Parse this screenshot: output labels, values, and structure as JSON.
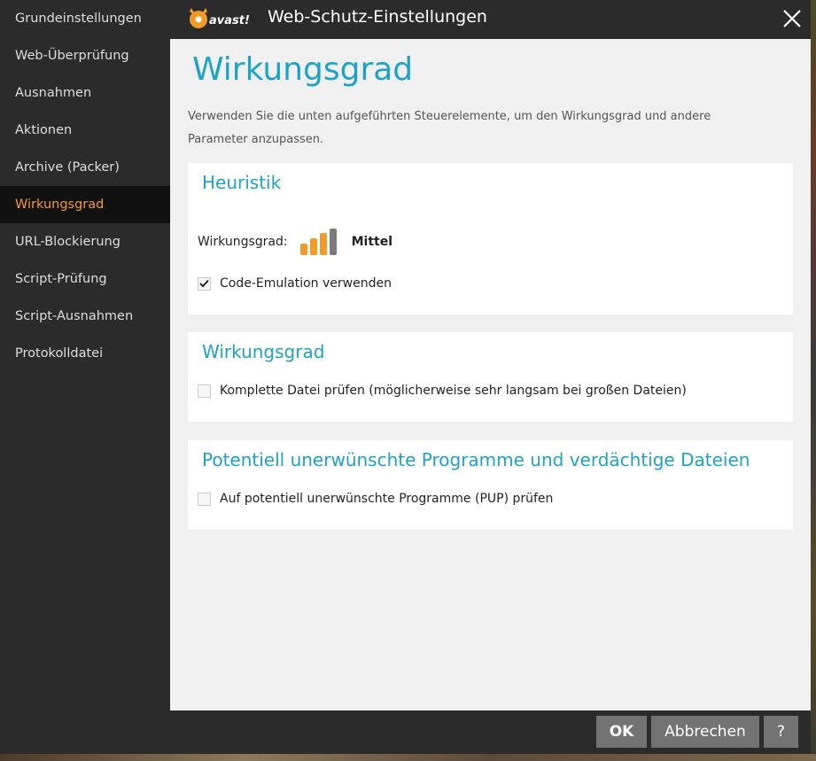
{
  "window": {
    "brand": "avast!",
    "title": "Web-Schutz-Einstellungen"
  },
  "sidebar": {
    "items": [
      {
        "label": "Grundeinstellungen",
        "active": false
      },
      {
        "label": "Web-Überprüfung",
        "active": false
      },
      {
        "label": "Ausnahmen",
        "active": false
      },
      {
        "label": "Aktionen",
        "active": false
      },
      {
        "label": "Archive (Packer)",
        "active": false
      },
      {
        "label": "Wirkungsgrad",
        "active": true
      },
      {
        "label": "URL-Blockierung",
        "active": false
      },
      {
        "label": "Script-Prüfung",
        "active": false
      },
      {
        "label": "Script-Ausnahmen",
        "active": false
      },
      {
        "label": "Protokolldatei",
        "active": false
      }
    ]
  },
  "main": {
    "title": "Wirkungsgrad",
    "description": "Verwenden Sie die unten aufgeführten Steuerelemente, um den Wirkungsgrad und andere Parameter anzupassen.",
    "sections": {
      "heuristik": {
        "title": "Heuristik",
        "level_label": "Wirkungsgrad:",
        "level_value": "Mittel",
        "level_filled": 3,
        "level_total": 4,
        "code_emulation": {
          "label": "Code-Emulation verwenden",
          "checked": true
        }
      },
      "wirkungsgrad": {
        "title": "Wirkungsgrad",
        "full_scan": {
          "label": "Komplette Datei prüfen (möglicherweise sehr langsam bei großen Dateien)",
          "checked": false
        }
      },
      "pup": {
        "title": "Potentiell unerwünschte Programme und verdächtige Dateien",
        "pup_check": {
          "label": "Auf potentiell unerwünschte Programme (PUP) prüfen",
          "checked": false
        }
      }
    }
  },
  "footer": {
    "ok_label": "OK",
    "cancel_label": "Abbrechen",
    "help_label": "?"
  },
  "colors": {
    "accent": "#1ea3c7",
    "brand_orange": "#f29a2a",
    "level_empty": "#7a7a7a"
  },
  "icons": {
    "close": "close-icon",
    "check": "checkmark-icon",
    "logo": "avast-logo-icon"
  }
}
